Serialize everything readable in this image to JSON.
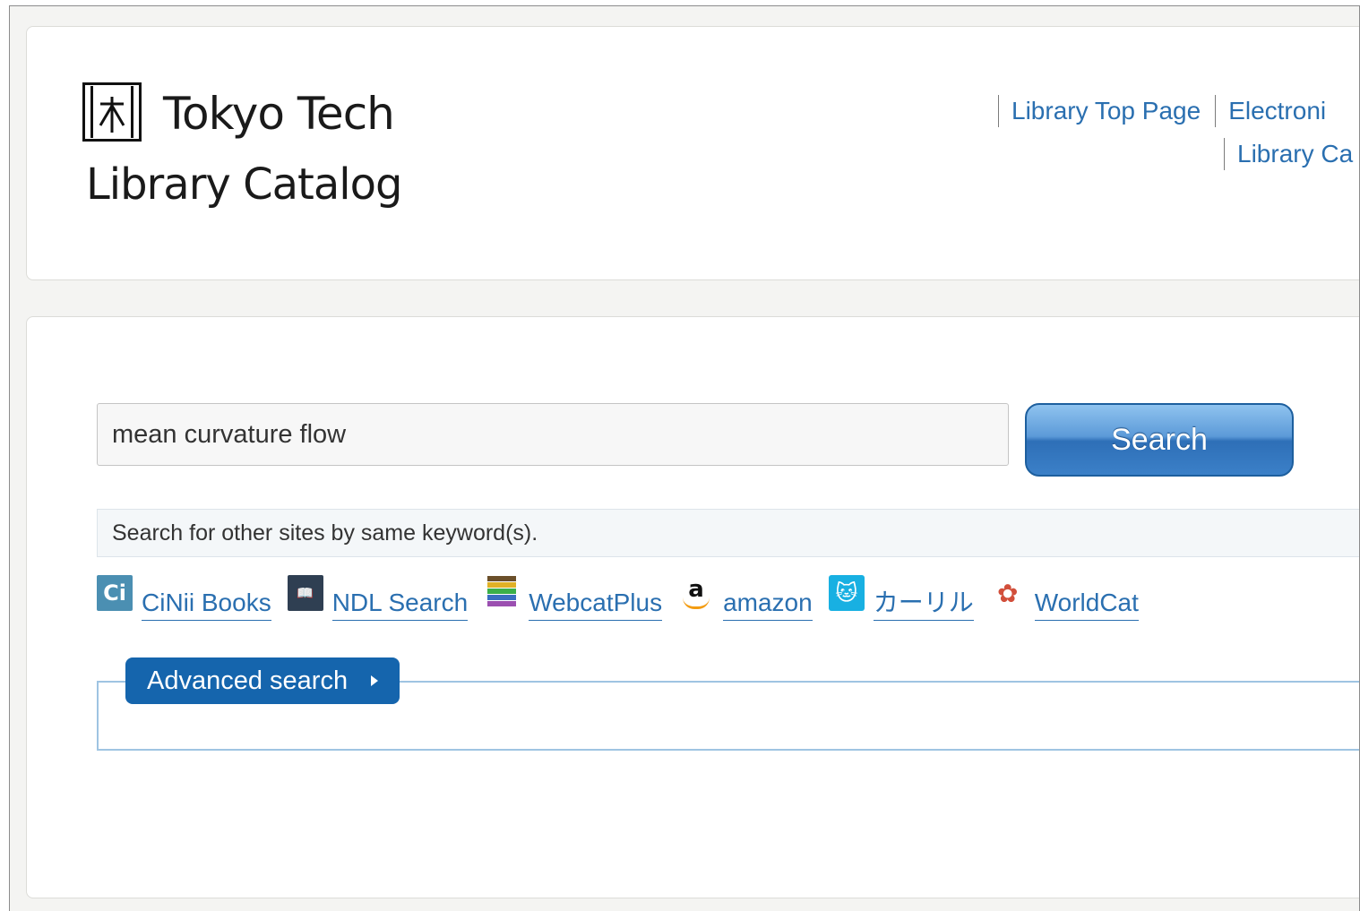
{
  "logo": {
    "name": "Tokyo Tech",
    "subtitle": "Library Catalog"
  },
  "topnav": {
    "row1": [
      "Library Top Page",
      "Electroni"
    ],
    "row2": [
      "Library Ca"
    ]
  },
  "search": {
    "value": "mean curvature flow",
    "button_label": "Search"
  },
  "other_sites": {
    "label": "Search for other sites by same keyword(s).",
    "links": [
      {
        "label": "CiNii Books",
        "icon": "cinii-icon",
        "icon_text": "Ci"
      },
      {
        "label": "NDL Search",
        "icon": "ndl-icon",
        "icon_text": "📖"
      },
      {
        "label": "WebcatPlus",
        "icon": "webcatplus-icon"
      },
      {
        "label": "amazon",
        "icon": "amazon-icon",
        "icon_text": "a"
      },
      {
        "label": "カーリル",
        "icon": "calil-icon",
        "icon_text": "🐱"
      },
      {
        "label": "WorldCat",
        "icon": "worldcat-icon",
        "icon_text": "✿"
      }
    ]
  },
  "advanced": {
    "label": "Advanced search"
  },
  "colors": {
    "link": "#2a6fb0",
    "accent": "#1565ad",
    "button_top": "#8fc3ef",
    "button_bottom": "#2e6fb7"
  }
}
